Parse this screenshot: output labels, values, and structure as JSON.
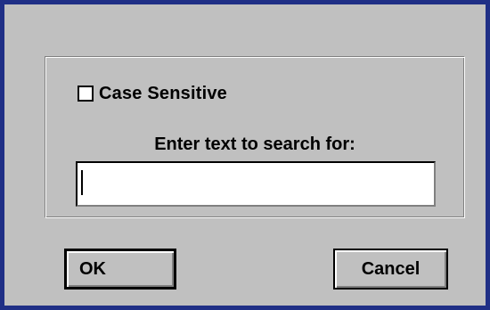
{
  "dialog": {
    "case_sensitive": {
      "label": "Case Sensitive",
      "checked": false
    },
    "search": {
      "prompt": "Enter text to search for:",
      "value": ""
    },
    "buttons": {
      "ok_label": "OK",
      "cancel_label": "Cancel"
    }
  }
}
